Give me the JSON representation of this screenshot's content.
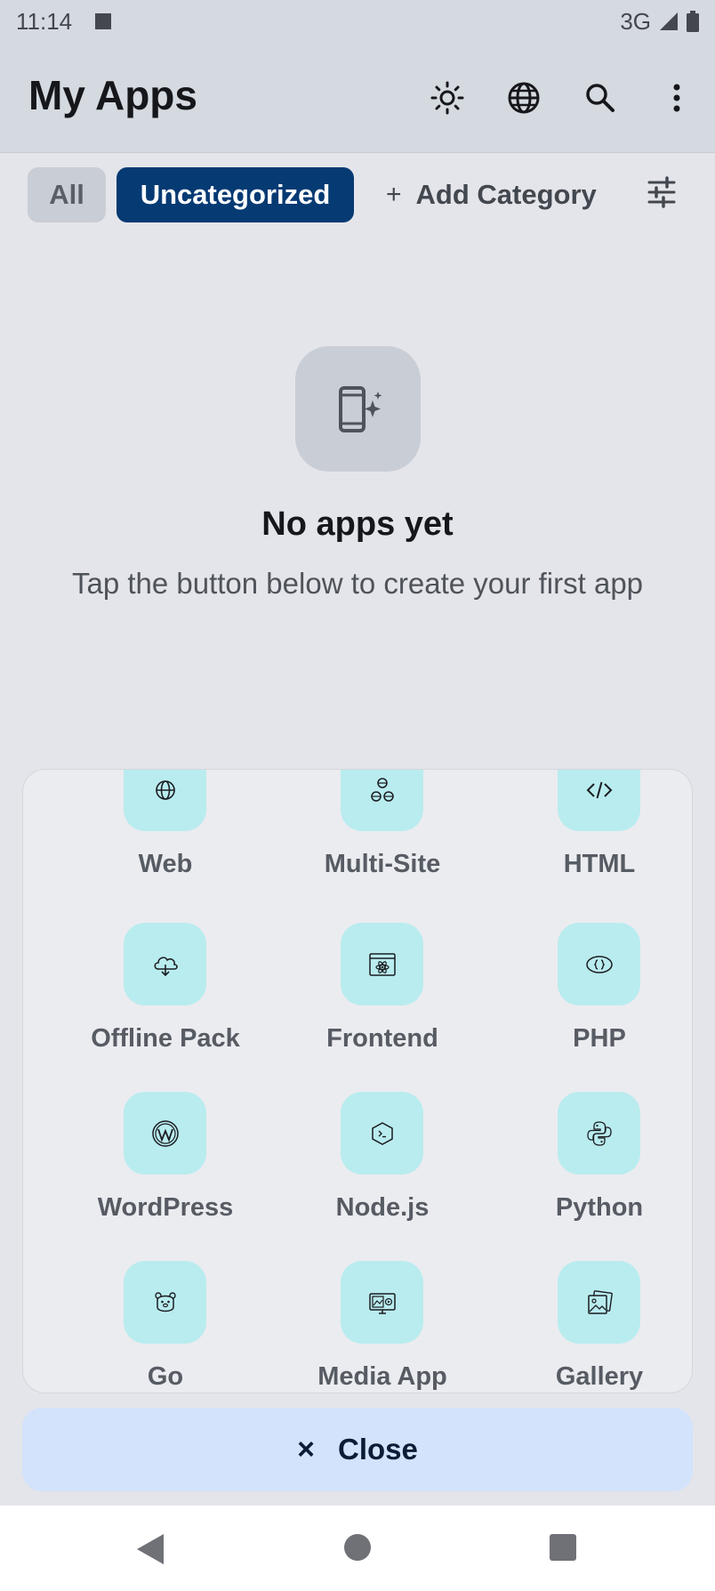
{
  "status_bar": {
    "time": "11:14",
    "network": "3G"
  },
  "app_bar": {
    "title": "My Apps",
    "actions": [
      {
        "name": "theme",
        "icon": "sun-icon"
      },
      {
        "name": "language",
        "icon": "globe-icon"
      },
      {
        "name": "search",
        "icon": "search-icon"
      },
      {
        "name": "more",
        "icon": "more-vertical-icon"
      }
    ]
  },
  "categories": {
    "all_label": "All",
    "selected_label": "Uncategorized",
    "add_label": "Add Category",
    "add_icon": "+"
  },
  "empty_state": {
    "icon": "phone-sparkle-icon",
    "title": "No apps yet",
    "subtitle": "Tap the button below to create your first app"
  },
  "app_types": [
    {
      "label": "Web",
      "icon": "globe-icon"
    },
    {
      "label": "Multi-Site",
      "icon": "multi-globe-icon"
    },
    {
      "label": "HTML",
      "icon": "code-icon"
    },
    {
      "label": "Offline Pack",
      "icon": "cloud-download-icon"
    },
    {
      "label": "Frontend",
      "icon": "react-window-icon"
    },
    {
      "label": "PHP",
      "icon": "php-icon"
    },
    {
      "label": "WordPress",
      "icon": "wordpress-icon"
    },
    {
      "label": "Node.js",
      "icon": "nodejs-icon"
    },
    {
      "label": "Python",
      "icon": "python-icon"
    },
    {
      "label": "Go",
      "icon": "gopher-icon"
    },
    {
      "label": "Media App",
      "icon": "media-icon"
    },
    {
      "label": "Gallery",
      "icon": "gallery-icon"
    }
  ],
  "close_button": {
    "label": "Close",
    "icon": "×"
  },
  "colors": {
    "accent": "#053a73",
    "tile": "#b9ecef",
    "close_bg": "#d2e3fb"
  }
}
